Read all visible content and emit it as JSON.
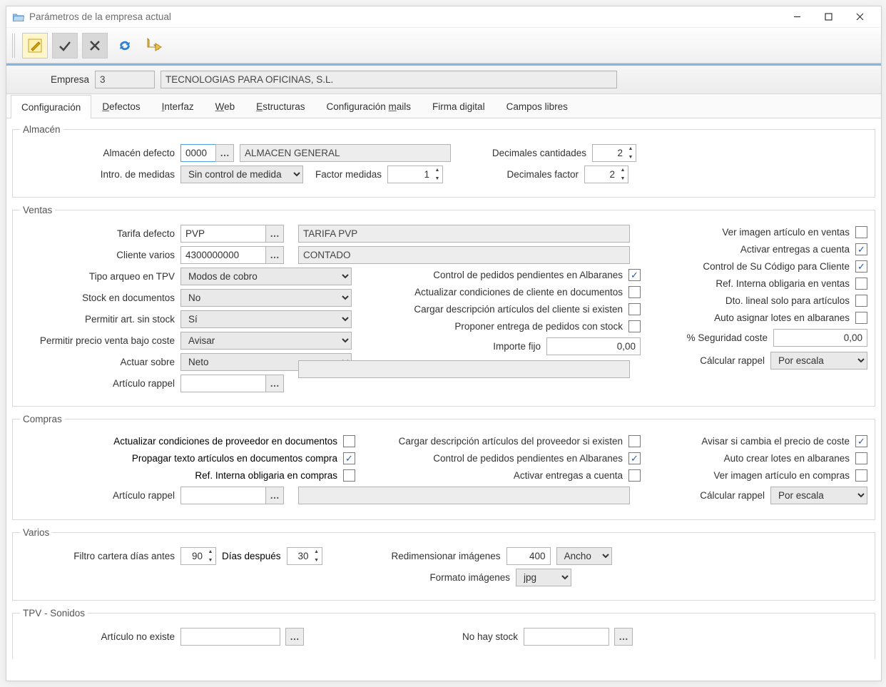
{
  "window": {
    "title": "Parámetros de la empresa actual"
  },
  "header": {
    "empresa_label": "Empresa",
    "empresa_code": "3",
    "empresa_name": "TECNOLOGIAS PARA OFICINAS, S.L."
  },
  "tabs": {
    "configuracion": "Configuración",
    "defectos": "Defectos",
    "interfaz": "Interfaz",
    "web": "Web",
    "estructuras": "Estructuras",
    "conf_mails": "Configuración mails",
    "firma": "Firma digital",
    "campos": "Campos libres"
  },
  "almacen": {
    "legend": "Almacén",
    "defecto_label": "Almacén defecto",
    "defecto_code": "0000",
    "defecto_name": "ALMACEN GENERAL",
    "intro_medidas_label": "Intro. de medidas",
    "intro_medidas_value": "Sin control de medida",
    "factor_medidas_label": "Factor medidas",
    "factor_medidas_value": "1",
    "dec_cant_label": "Decimales cantidades",
    "dec_cant_value": "2",
    "dec_factor_label": "Decimales factor",
    "dec_factor_value": "2"
  },
  "ventas": {
    "legend": "Ventas",
    "tarifa_label": "Tarifa defecto",
    "tarifa_code": "PVP",
    "tarifa_name": "TARIFA PVP",
    "cliente_label": "Cliente varios",
    "cliente_code": "4300000000",
    "cliente_name": "CONTADO",
    "tipo_arqueo_label": "Tipo arqueo en TPV",
    "tipo_arqueo_value": "Modos de cobro",
    "stock_doc_label": "Stock en documentos",
    "stock_doc_value": "No",
    "permit_sinstock_label": "Permitir art. sin stock",
    "permit_sinstock_value": "Sí",
    "permit_bajocoste_label": "Permitir precio venta bajo coste",
    "permit_bajocoste_value": "Avisar",
    "actuar_label": "Actuar sobre",
    "actuar_value": "Neto",
    "articulo_rappel_label": "Artículo rappel",
    "mid": {
      "control_pedidos": "Control de pedidos pendientes en Albaranes",
      "actualizar_cond": "Actualizar condiciones de cliente en documentos",
      "cargar_desc": "Cargar descripción artículos del cliente si existen",
      "proponer": "Proponer entrega de pedidos con stock",
      "importe_fijo_label": "Importe fijo",
      "importe_fijo_value": "0,00"
    },
    "right": {
      "ver_imagen": "Ver imagen artículo en ventas",
      "activar_entregas": "Activar entregas a cuenta",
      "control_sucodigo": "Control de Su Código para Cliente",
      "ref_interna": "Ref. Interna obligaria en ventas",
      "dto_lineal": "Dto. lineal solo para artículos",
      "auto_lotes": "Auto asignar lotes en albaranes",
      "seguridad_label": "% Seguridad coste",
      "seguridad_value": "0,00",
      "calcular_rappel_label": "Cálcular rappel",
      "calcular_rappel_value": "Por escala"
    }
  },
  "compras": {
    "legend": "Compras",
    "actualizar_cond": "Actualizar condiciones de proveedor en documentos",
    "propagar": "Propagar texto artículos en documentos compra",
    "ref_interna": "Ref. Interna obligaria en compras",
    "articulo_rappel_label": "Artículo rappel",
    "cargar_desc": "Cargar descripción artículos del proveedor si existen",
    "control_pedidos": "Control de pedidos pendientes en Albaranes",
    "activar_entregas": "Activar entregas a cuenta",
    "avisar_precio": "Avisar si cambia el precio de coste",
    "auto_lotes": "Auto crear lotes en albaranes",
    "ver_imagen": "Ver imagen artículo en compras",
    "calcular_rappel_label": "Cálcular rappel",
    "calcular_rappel_value": "Por escala"
  },
  "varios": {
    "legend": "Varios",
    "filtro_label": "Filtro cartera días antes",
    "filtro_value": "90",
    "dias_despues_label": "Días después",
    "dias_despues_value": "30",
    "redim_label": "Redimensionar imágenes",
    "redim_value": "400",
    "redim_mode": "Ancho",
    "formato_label": "Formato imágenes",
    "formato_value": "jpg"
  },
  "tpv": {
    "legend": "TPV - Sonidos",
    "no_existe_label": "Artículo no existe",
    "no_stock_label": "No hay stock"
  }
}
